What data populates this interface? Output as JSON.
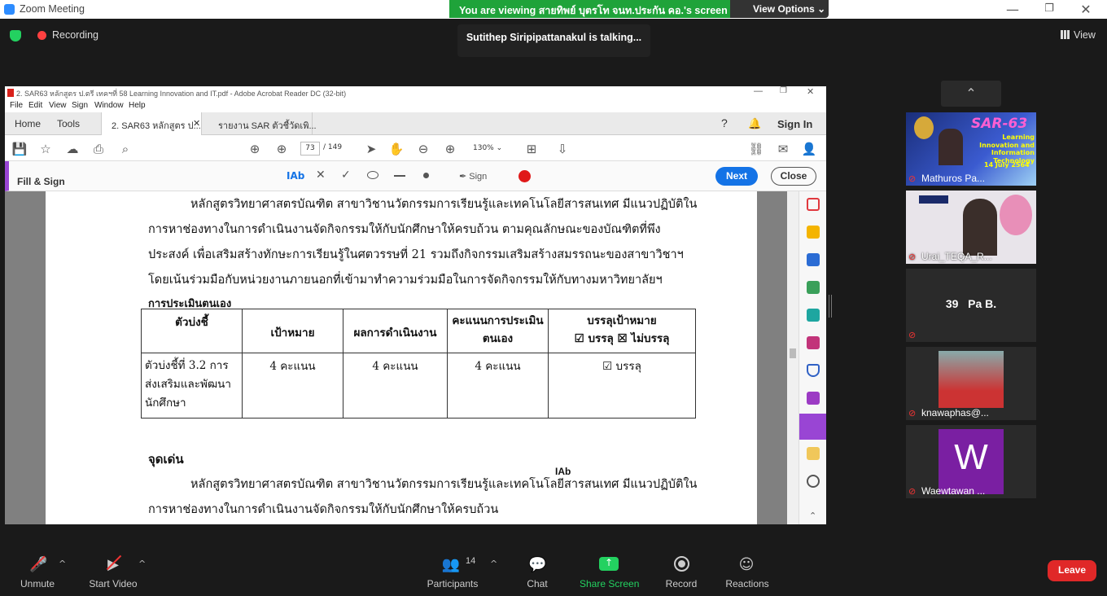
{
  "window": {
    "title": "Zoom Meeting",
    "banner_text": "You are viewing สายทิพย์ บุตรโท จนท.ประกัน คอ.'s screen",
    "view_options": "View Options ⌄",
    "min": "—",
    "max": "❐",
    "close": "✕"
  },
  "meeting": {
    "recording_label": "Recording",
    "talking": "Sutithep Siripipattanakul is talking...",
    "view_label": "View"
  },
  "acrobat": {
    "title": "2. SAR63 หลักสูตร ป.ตรี เทคฯที่ 58 Learning Innovation and IT.pdf - Adobe Acrobat Reader DC (32-bit)",
    "menu": [
      "File",
      "Edit",
      "View",
      "Sign",
      "Window",
      "Help"
    ],
    "tabs": {
      "home": "Home",
      "tools": "Tools",
      "doc1": "2. SAR63 หลักสูตร ป...",
      "doc2": "รายงาน SAR ตัวชี้วัดเพิ..."
    },
    "sign_in": "Sign In",
    "page_current": "73",
    "page_total": "/ 149",
    "zoom": "130%",
    "fill_sign_label": "Fill & Sign",
    "tool_text": "IAb",
    "sign_label": "Sign",
    "next": "Next",
    "close": "Close"
  },
  "document": {
    "para1_lines": [
      "หลักสูตรวิทยาศาสตรบัณฑิต สาขาวิชานวัตกรรมการเรียนรู้และเทคโนโลยีสารสนเทศ มีแนวปฏิบัติใน",
      "การหาช่องทางในการดำเนินงานจัดกิจกรรมให้กับนักศึกษาให้ครบถ้วน ตามคุณลักษณะของบัณฑิตที่พึง",
      "ประสงค์ เพื่อเสริมสร้างทักษะการเรียนรู้ในศตวรรษที่ 21 รวมถึงกิจกรรมเสริมสร้างสมรรถนะของสาขาวิชาฯ",
      "โดยเน้นร่วมมือกับหน่วยงานภายนอกที่เข้ามาทำความร่วมมือในการจัดกิจกรรมให้กับทางมหาวิทยาลัยฯ"
    ],
    "self_eval_heading": "การประเมินตนเอง",
    "table": {
      "headers": [
        "ตัวบ่งชี้",
        "เป้าหมาย",
        "ผลการดำเนินงาน",
        "คะแนนการประเมิน ตนเอง",
        "บรรลุเป้าหมาย"
      ],
      "header_sub": "☑ บรรลุ ☒ ไม่บรรลุ",
      "row": [
        "ตัวบ่งชี้ที่ 3.2 การส่งเสริมและพัฒนานักศึกษา",
        "4 คะแนน",
        "4 คะแนน",
        "4 คะแนน",
        "☑ บรรลุ"
      ]
    },
    "strengths_heading": "จุดเด่น",
    "para2_lines": [
      "หลักสูตรวิทยาศาสตรบัณฑิต สาขาวิชานวัตกรรมการเรียนรู้และเทคโนโลยีสารสนเทศ มีแนวปฏิบัติใน",
      "การหาช่องทางในการดำเนินงานจัดกิจกรรมให้กับนักศึกษาให้ครบถ้วน"
    ],
    "cursor_text": "IAb"
  },
  "participants_gallery": [
    {
      "name": "Mathuros Pa...",
      "slide_title": "SAR-63",
      "slide_sub": "Learning Innovation and Information Technology",
      "slide_date": "14 July 2564"
    },
    {
      "name": "Urai_TEQA_R..."
    },
    {
      "name": "",
      "center_text": "39   Pa B."
    },
    {
      "name": "knawaphas@..."
    },
    {
      "name": "Waewtawan ...",
      "avatar_letter": "W"
    }
  ],
  "toolbar": {
    "unmute": "Unmute",
    "start_video": "Start Video",
    "participants": "Participants",
    "participants_count": "14",
    "chat": "Chat",
    "share_screen": "Share Screen",
    "record": "Record",
    "reactions": "Reactions",
    "leave": "Leave"
  },
  "colors": {
    "share_green": "#23d160",
    "leave_red": "#e02828",
    "acrobat_blue": "#1473e6",
    "fill_sign_purple": "#9945d4"
  }
}
